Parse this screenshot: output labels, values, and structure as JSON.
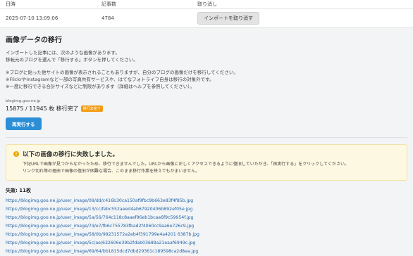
{
  "table": {
    "headers": {
      "date": "日時",
      "count": "記事数",
      "undo": "取り消し"
    },
    "row": {
      "date": "2025-07-10 13:09:06",
      "count": "4784",
      "undo_button": "インポートを取り消す"
    }
  },
  "migration": {
    "title": "画像データの移行",
    "intro": [
      "インポートした記事には、次のような画像があります。",
      "移転元のブログを選んで「移行する」ボタンを押してください。"
    ],
    "notes": [
      "※ブログに貼った他サイトの画像が表示されることもありますが、自分のブログの画像だけを移行してください。",
      "※FlickrやInstagramなど一部の写真共有サービスや、はてなフォトライフ自身は移行の対象外です。",
      "※一度に移行できる合計サイズなどに制限があります（詳細はヘルプを参照してください）。"
    ],
    "site": "blogimg.goo.ne.jp",
    "progress": "15875 / 11945 枚 移行完了",
    "badge": "移行未完了",
    "retry_button": "再実行する"
  },
  "alert": {
    "title": "以下の画像の移行に失敗しました。",
    "body": [
      "下記URLで画像が見つからなかったため、移行できませんでした。URLから画像に正しくアクセスできるように復旧していただき、「再実行する」をクリックしてください。",
      "リンク切れ等の理由で画像の復旧が困難な場合、このまま移行作業を終えてもかまいません。"
    ]
  },
  "failed": {
    "label": "失敗: 11枚",
    "urls": [
      "https://blogimg.goo.ne.jp/user_image/09/dd/c416b30ca150af9fbc9b663e83f4f85b.jpg",
      "https://blogimg.goo.ne.jp/user_image/13/cc/febc552aeed4ab67920406b892ef05e.jpg",
      "https://blogimg.goo.ne.jp/user_image/5a/56/764c118c8aaef96eb1bcaa6f9c59954f.jpg",
      "https://blogimg.goo.ne.jp/user_image/7d/e7/fb6c755783fbad2f4060cc9aa6e726c9.jpg",
      "https://blogimg.goo.ne.jp/user_image/58/0b/99231572a2eb4f391799e4a4201 6387b.jpg",
      "https://blogimg.goo.ne.jp/user_image/5c/ae/632606e39b2fdab03689a21eaaf6949c.jpg",
      "https://blogimg.goo.ne.jp/user_image/69/64/bb1815dcd7dbd29361c189598ca2d8ea.jpg"
    ]
  },
  "colors": {
    "primary": "#2d8ed8",
    "warning": "#f39c12",
    "alert_bg": "#fdf8e2",
    "link": "#2266aa"
  }
}
